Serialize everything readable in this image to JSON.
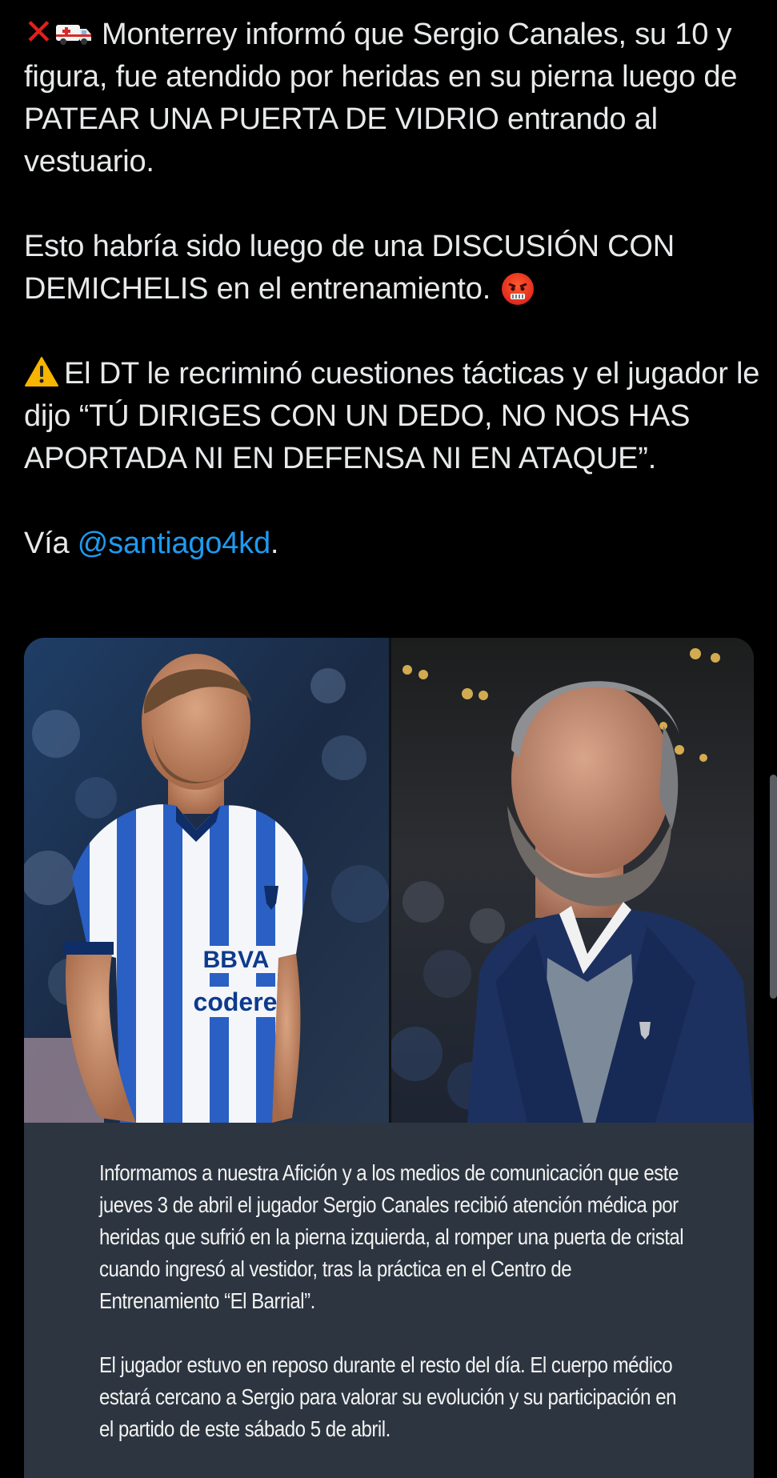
{
  "tweet": {
    "p1": "Monterrey informó que Sergio Canales, su 10 y figura, fue atendido por heridas en su pierna luego de PATEAR UNA PUERTA DE VIDRIO entrando al vestuario.",
    "p2": "Esto habría sido luego de una DISCUSIÓN CON DEMICHELIS en el entrenamiento.",
    "p3": "El DT le recriminó cuestiones tácticas y el jugador le dijo “TÚ DIRIGES CON UN DEDO, NO NOS HAS APORTADA NI EN DEFENSA NI EN ATAQUE”.",
    "p4_prefix": "Vía",
    "mention": "@santiago4kd",
    "p4_suffix": ".",
    "icons": [
      "cross-mark-icon",
      "ambulance-icon",
      "angry-face-icon",
      "warning-icon"
    ]
  },
  "media": {
    "left_photo": {
      "shirt_sponsor_1": "BBVA",
      "shirt_sponsor_2": "codere"
    },
    "statement": {
      "p1": "Informamos a nuestra Afición y a los medios de comunicación que este jueves 3 de abril el jugador Sergio Canales recibió atención médica por heridas que sufrió en la pierna izquierda, al romper una puerta de cristal cuando ingresó al vestidor, tras la práctica en el Centro de Entrenamiento “El Barrial”.",
      "p2": "El jugador estuvo en reposo durante el resto del día. El cuerpo médico estará cercano a Sergio para valorar su evolución y su participación en el partido de este sábado 5 de abril."
    }
  },
  "colors": {
    "background": "#000000",
    "text": "#e7e9ea",
    "mention": "#1d9bf0",
    "statement_bg": "#2d3540"
  }
}
